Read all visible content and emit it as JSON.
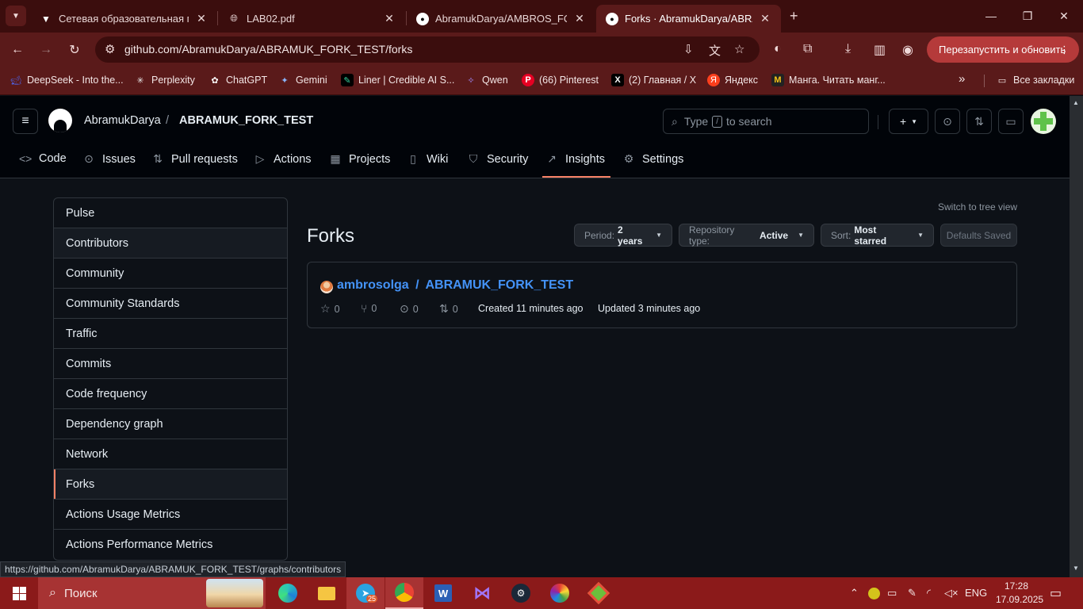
{
  "browser": {
    "tabs": [
      {
        "title": "Сетевая образовательная пла",
        "icon": "network-edu-icon"
      },
      {
        "title": "LAB02.pdf",
        "icon": "globe-icon"
      },
      {
        "title": "AbramukDarya/AMBROS_FORK",
        "icon": "github-icon"
      },
      {
        "title": "Forks · AbramukDarya/ABRAMU",
        "icon": "github-icon"
      }
    ],
    "address": "github.com/AbramukDarya/ABRAMUK_FORK_TEST/forks",
    "relaunch_label": "Перезапустить и обновить",
    "bookmarks": [
      {
        "label": "DeepSeek - Into the...",
        "icon": "deepseek-icon",
        "color": "#4d6bfe"
      },
      {
        "label": "Perplexity",
        "icon": "perplexity-icon",
        "color": "#20808d"
      },
      {
        "label": "ChatGPT",
        "icon": "chatgpt-icon",
        "color": "#ffffff"
      },
      {
        "label": "Gemini",
        "icon": "gemini-icon",
        "color": "#8ab4f8"
      },
      {
        "label": "Liner | Credible AI S...",
        "icon": "liner-icon",
        "color": "#38d39f"
      },
      {
        "label": "Qwen",
        "icon": "qwen-icon",
        "color": "#7b61ff"
      },
      {
        "label": "(66) Pinterest",
        "icon": "pinterest-icon",
        "color": "#e60023"
      },
      {
        "label": "(2) Главная / X",
        "icon": "x-icon",
        "color": "#000000"
      },
      {
        "label": "Яндекс",
        "icon": "yandex-icon",
        "color": "#fc3f1d"
      },
      {
        "label": "Манга. Читать манг...",
        "icon": "manga-icon",
        "color": "#222222"
      }
    ],
    "all_bookmarks": "Все закладки",
    "status_url": "https://github.com/AbramukDarya/ABRAMUK_FORK_TEST/graphs/contributors"
  },
  "github": {
    "owner": "AbramukDarya",
    "separator": "/",
    "repo": "ABRAMUK_FORK_TEST",
    "search_prefix": "Type",
    "search_key": "/",
    "search_suffix": "to search",
    "repo_nav": [
      {
        "label": "Code",
        "icon": "code-icon",
        "glyph": "<>"
      },
      {
        "label": "Issues",
        "icon": "issue-icon",
        "glyph": "⊙"
      },
      {
        "label": "Pull requests",
        "icon": "pull-request-icon",
        "glyph": "⇅"
      },
      {
        "label": "Actions",
        "icon": "play-icon",
        "glyph": "▷"
      },
      {
        "label": "Projects",
        "icon": "table-icon",
        "glyph": "▦"
      },
      {
        "label": "Wiki",
        "icon": "book-icon",
        "glyph": "▯"
      },
      {
        "label": "Security",
        "icon": "shield-icon",
        "glyph": "⛉"
      },
      {
        "label": "Insights",
        "icon": "graph-icon",
        "glyph": "↗"
      },
      {
        "label": "Settings",
        "icon": "gear-icon",
        "glyph": "⚙"
      }
    ]
  },
  "sidebar": {
    "items": [
      {
        "label": "Pulse"
      },
      {
        "label": "Contributors"
      },
      {
        "label": "Community"
      },
      {
        "label": "Community Standards"
      },
      {
        "label": "Traffic"
      },
      {
        "label": "Commits"
      },
      {
        "label": "Code frequency"
      },
      {
        "label": "Dependency graph"
      },
      {
        "label": "Network"
      },
      {
        "label": "Forks"
      },
      {
        "label": "Actions Usage Metrics"
      },
      {
        "label": "Actions Performance Metrics"
      }
    ],
    "selected": "Forks",
    "hovered": "Contributors"
  },
  "forks": {
    "title": "Forks",
    "switch_view": "Switch to tree view",
    "filters": [
      {
        "label": "Period:",
        "value": "2 years"
      },
      {
        "label": "Repository type:",
        "value": "Active"
      },
      {
        "label": "Sort:",
        "value": "Most starred"
      }
    ],
    "defaults_saved": "Defaults Saved",
    "items": [
      {
        "owner": "ambrosolga",
        "separator": "/",
        "repo": "ABRAMUK_FORK_TEST",
        "stars": "0",
        "forks": "0",
        "issues": "0",
        "pull_requests": "0",
        "created": "Created 11 minutes ago",
        "updated": "Updated 3 minutes ago"
      }
    ]
  },
  "taskbar": {
    "search_label": "Поиск",
    "telegram_badge": "25",
    "language": "ENG",
    "time": "17:28",
    "date": "17.09.2025"
  },
  "colors": {
    "chrome_frame": "#3b0d0d",
    "chrome_toolbar": "#5a1a1a",
    "taskbar": "#8b1a1a",
    "github_bg": "#0d1117",
    "link": "#4493f8",
    "selected_accent": "#f78166"
  }
}
